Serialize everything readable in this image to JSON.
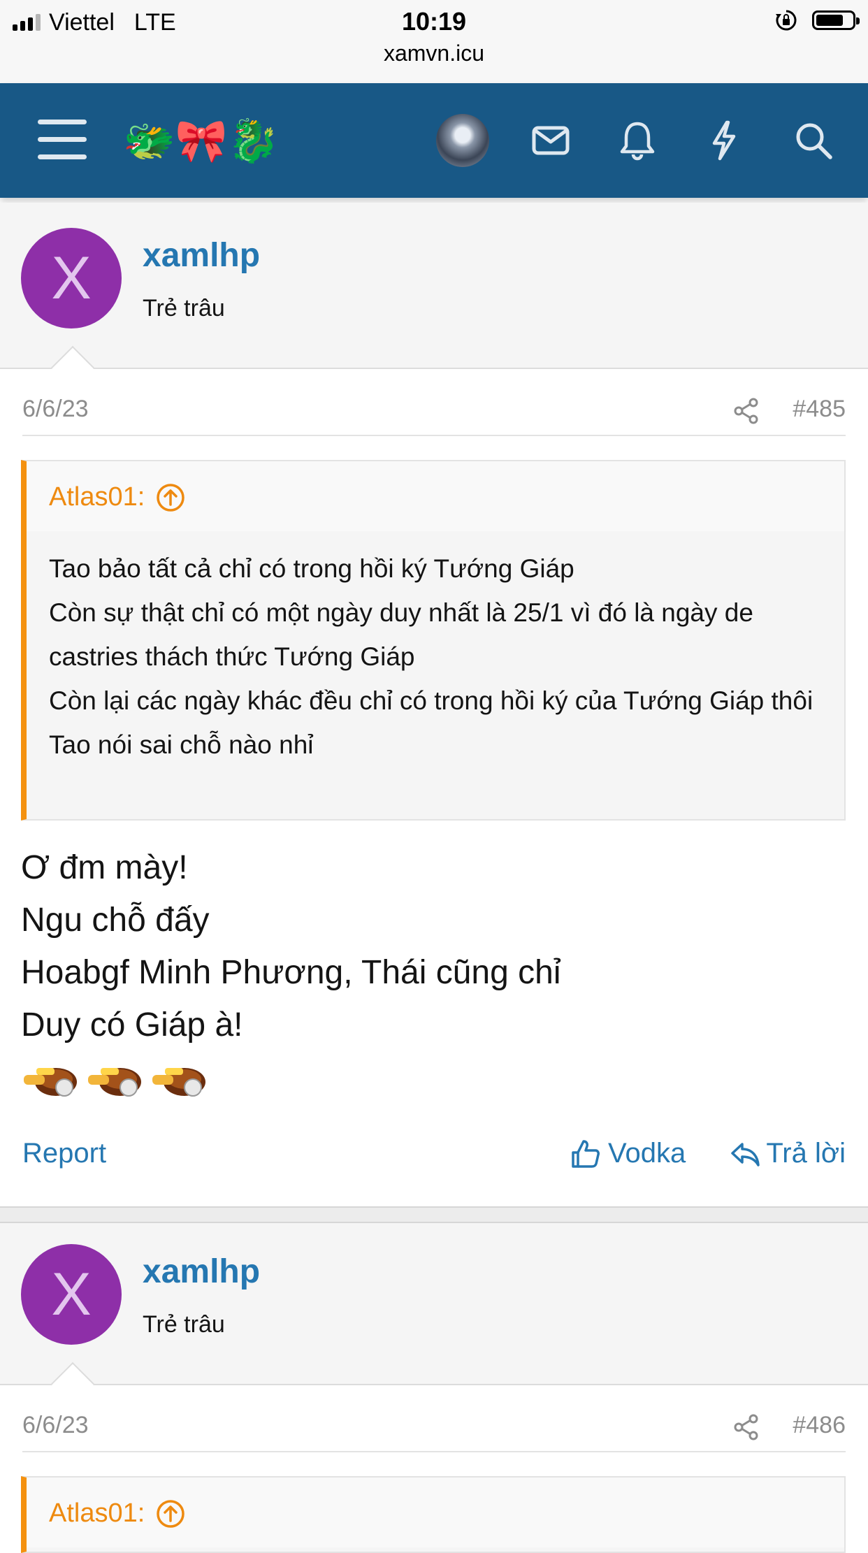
{
  "status_bar": {
    "carrier": "Viettel",
    "network": "LTE",
    "time": "10:19",
    "url": "xamvn.icu",
    "battery_level": 0.75
  },
  "header": {
    "logo_emoji": "🐲🎀🐉",
    "icons": [
      "menu-icon",
      "avatar",
      "mail-icon",
      "bell-icon",
      "lightning-icon",
      "search-icon"
    ],
    "bg_color": "#185886"
  },
  "posts": [
    {
      "avatar_letter": "X",
      "username": "xamlhp",
      "user_title": "Trẻ trâu",
      "date": "6/6/23",
      "post_number": "#485",
      "quote": {
        "author": "Atlas01:",
        "lines": [
          "Tao bảo tất cả chỉ có trong hồi ký Tướng Giáp",
          "Còn sự thật chỉ có một ngày duy nhất là 25/1 vì đó là ngày de castries thách thức Tướng Giáp",
          "Còn lại các ngày khác đều chỉ có trong hồi ký của Tướng Giáp thôi",
          "Tao nói sai chỗ nào nhỉ"
        ]
      },
      "message_lines": [
        "Ơ đm mày!",
        "Ngu chỗ đấy",
        "Hoabgf Minh Phương, Thái cũng chỉ",
        "Duy có Giáp à!"
      ],
      "actions": {
        "report": "Report",
        "like": "Vodka",
        "reply": "Trả lời"
      }
    },
    {
      "avatar_letter": "X",
      "username": "xamlhp",
      "user_title": "Trẻ trâu",
      "date": "6/6/23",
      "post_number": "#486",
      "quote": {
        "author": "Atlas01:"
      }
    }
  ],
  "colors": {
    "link": "#2577b1",
    "quote_accent": "#f4910f",
    "avatar_bg": "#8e2fa8"
  }
}
